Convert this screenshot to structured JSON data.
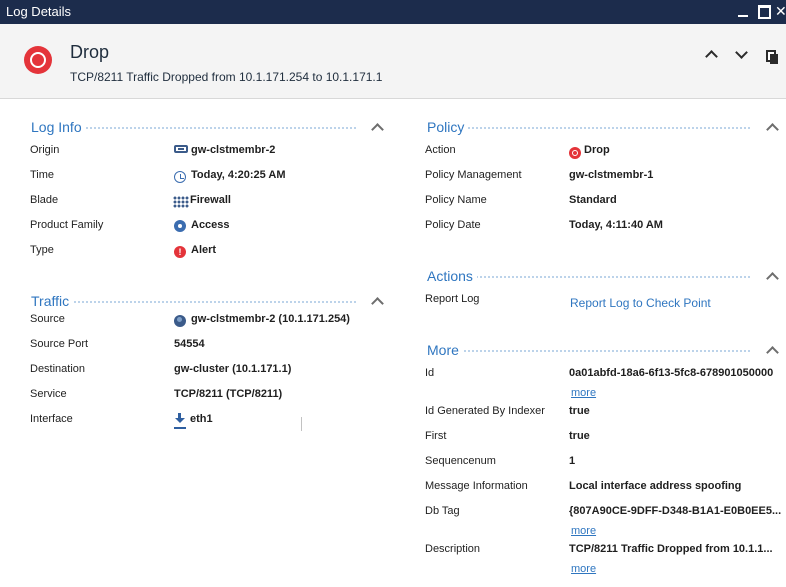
{
  "window": {
    "title": "Log Details",
    "close_glyph": "✕"
  },
  "header": {
    "title": "Drop",
    "subtitle": "TCP/8211 Traffic Dropped from 10.1.171.254 to 10.1.171.1"
  },
  "log_info": {
    "title": "Log Info",
    "rows": [
      {
        "label": "Origin",
        "value": "gw-clstmembr-2",
        "icon": "gateway-icon"
      },
      {
        "label": "Time",
        "value": "Today, 4:20:25 AM",
        "icon": "clock-icon"
      },
      {
        "label": "Blade",
        "value": "Firewall",
        "icon": "firewall-blade-icon"
      },
      {
        "label": "Product Family",
        "value": "Access",
        "icon": "access-icon"
      },
      {
        "label": "Type",
        "value": "Alert",
        "icon": "alert-icon"
      }
    ]
  },
  "traffic": {
    "title": "Traffic",
    "rows": [
      {
        "label": "Source",
        "value": "gw-clstmembr-2 (10.1.171.254)",
        "icon": "globe-icon"
      },
      {
        "label": "Source Port",
        "value": "54554"
      },
      {
        "label": "Destination",
        "value": "gw-cluster (10.1.171.1)"
      },
      {
        "label": "Service",
        "value": "TCP/8211 (TCP/8211)"
      },
      {
        "label": "Interface",
        "value": "eth1",
        "icon": "inbound-arrow-icon"
      }
    ]
  },
  "policy": {
    "title": "Policy",
    "rows": [
      {
        "label": "Action",
        "value": "Drop",
        "icon": "drop-icon"
      },
      {
        "label": "Policy Management",
        "value": "gw-clstmembr-1"
      },
      {
        "label": "Policy Name",
        "value": "Standard"
      },
      {
        "label": "Policy Date",
        "value": "Today, 4:11:40 AM"
      }
    ]
  },
  "actions": {
    "title": "Actions",
    "rows": [
      {
        "label": "Report Log",
        "link": "Report Log to Check Point"
      }
    ]
  },
  "more": {
    "title": "More",
    "more_label": "more",
    "rows": [
      {
        "label": "Id",
        "value": "0a01abfd-18a6-6f13-5fc8-678901050000"
      },
      {
        "label": "Id Generated By Indexer",
        "value": "true"
      },
      {
        "label": "First",
        "value": "true"
      },
      {
        "label": "Sequencenum",
        "value": "1"
      },
      {
        "label": "Message Information",
        "value": "Local interface address spoofing"
      },
      {
        "label": "Db Tag",
        "value": "{807A90CE-9DFF-D348-B1A1-E0B0EE5..."
      },
      {
        "label": "Description",
        "value": "TCP/8211 Traffic Dropped from 10.1.1..."
      }
    ]
  },
  "colors": {
    "titlebar": "#1c2c4c",
    "accent": "#2f76c0",
    "drop": "#e4343a"
  }
}
